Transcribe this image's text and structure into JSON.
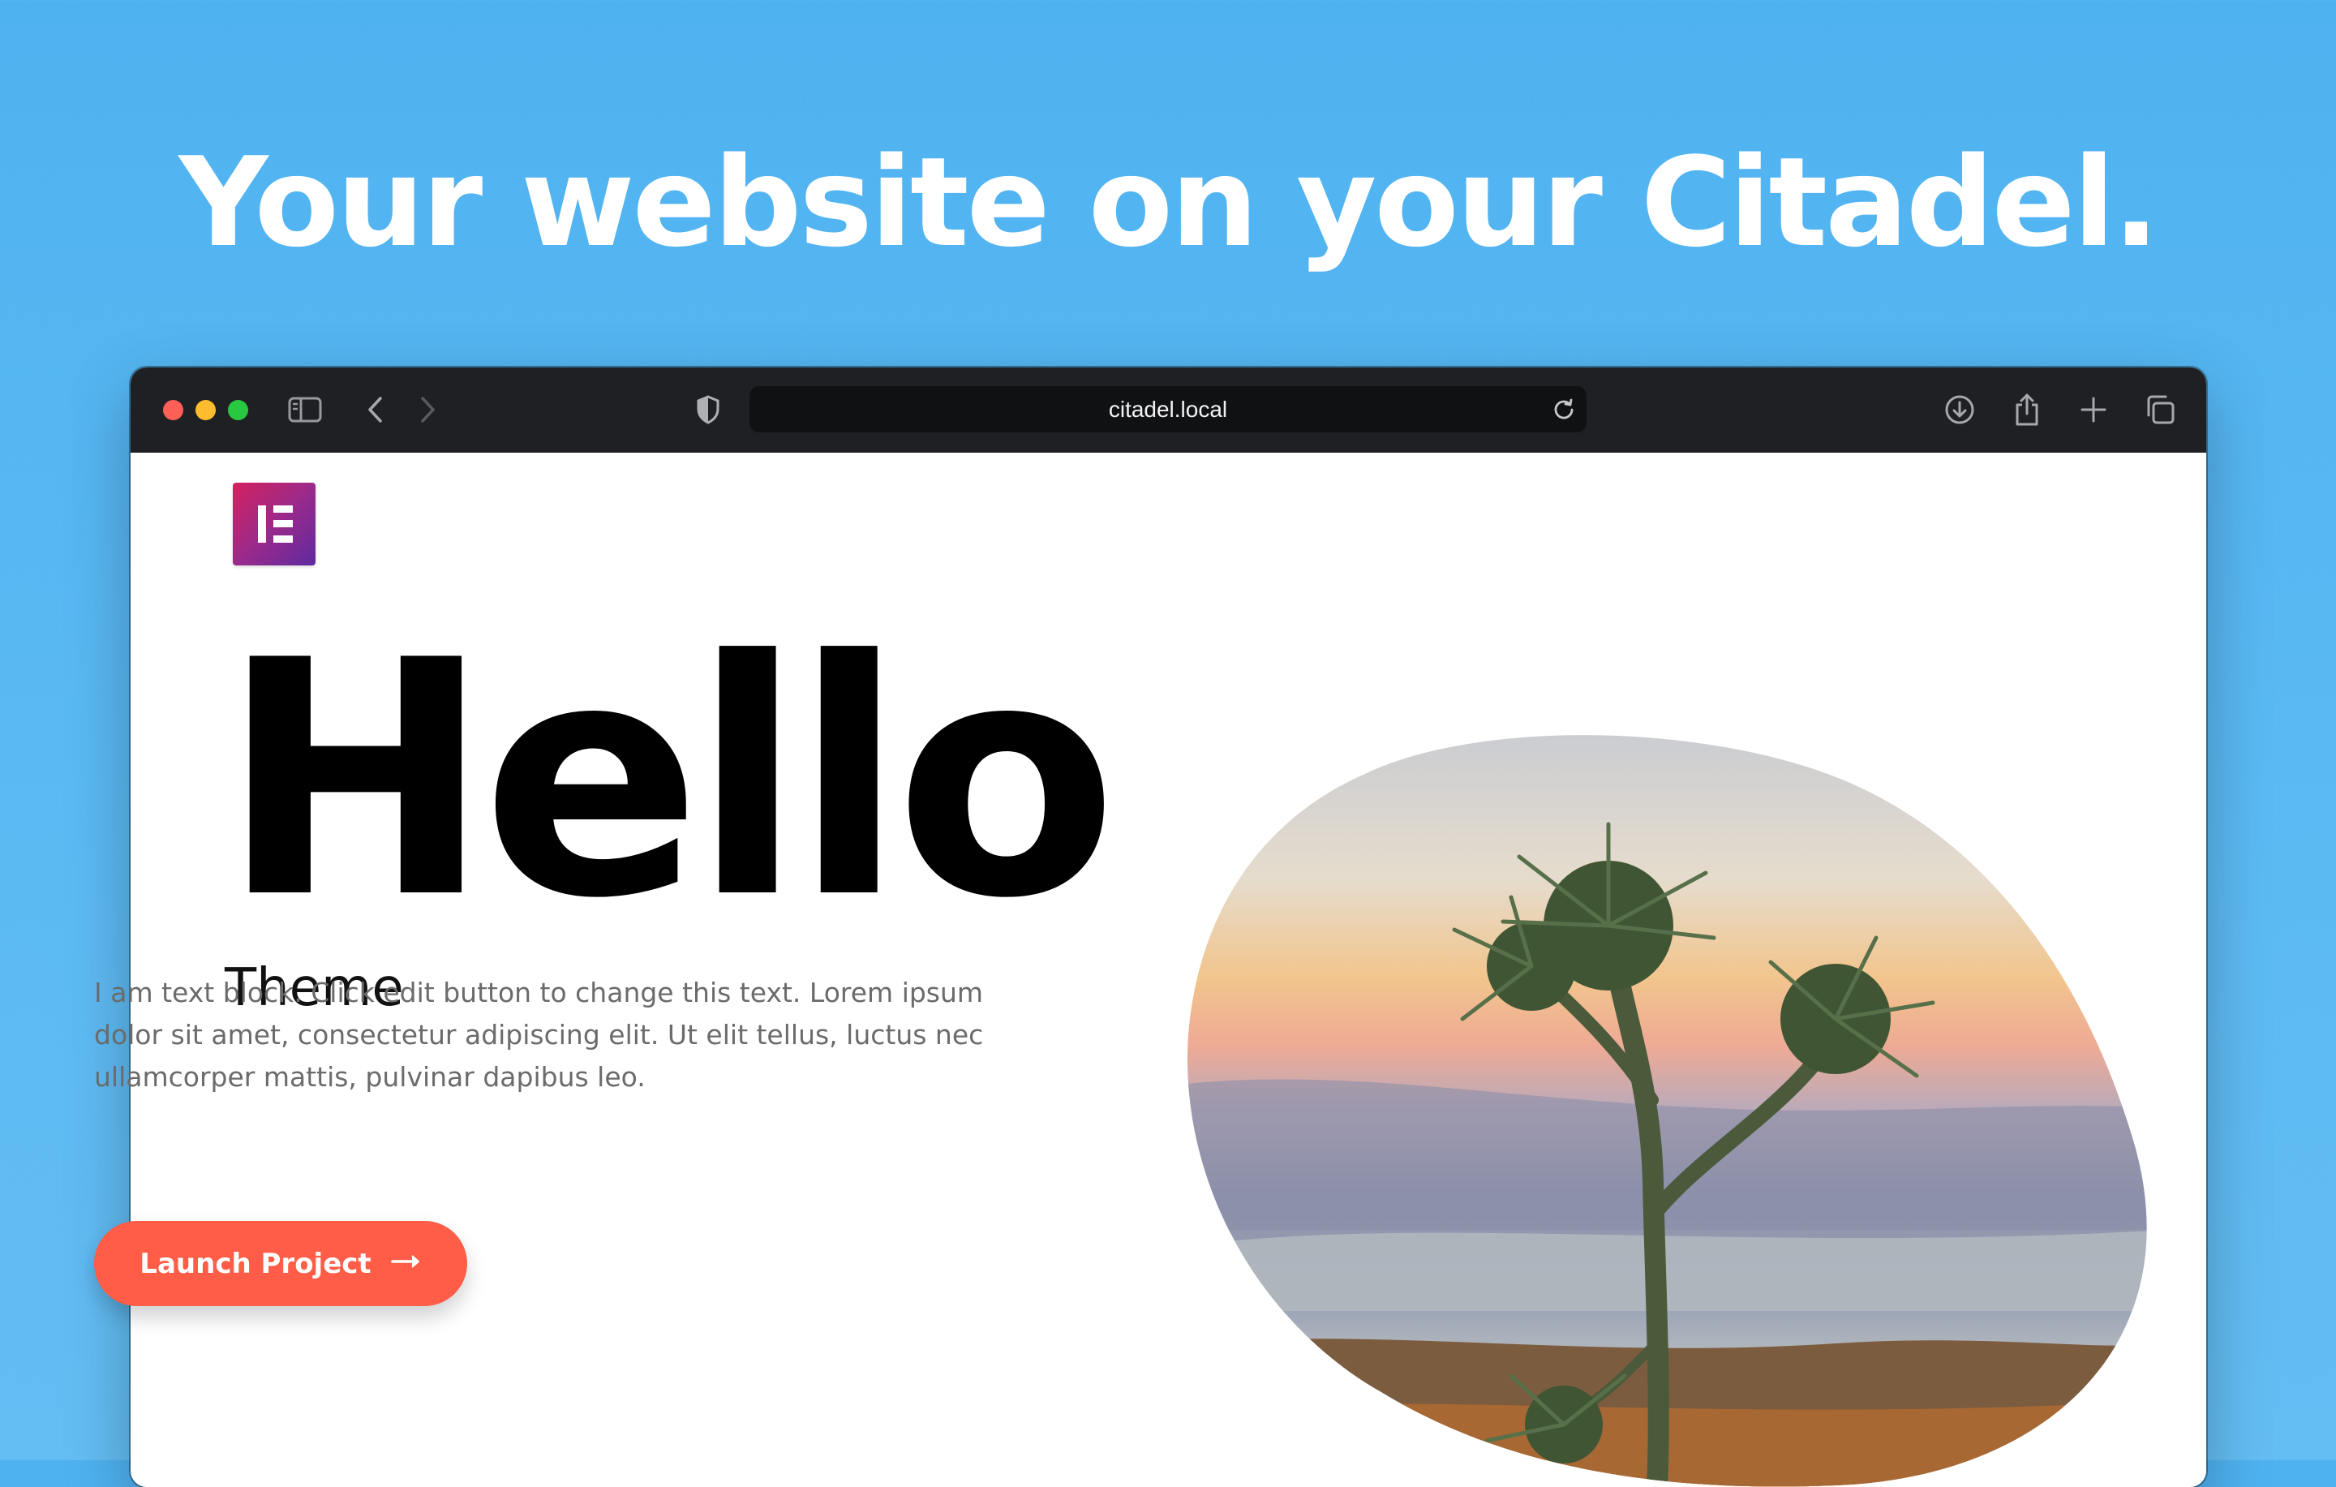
{
  "headline": "Your website on your Citadel.",
  "browser": {
    "url": "citadel.local",
    "icons": [
      "close-dot",
      "minimize-dot",
      "zoom-dot",
      "sidebar-icon",
      "back-icon",
      "forward-icon",
      "shield-icon",
      "reload-icon",
      "download-icon",
      "share-icon",
      "new-tab-icon",
      "tabs-overview-icon"
    ]
  },
  "page": {
    "logo_icon": "elementor-logo",
    "hero_title": "Hello",
    "subtitle": "Theme",
    "body": "I am text block. Click edit button to change this text. Lorem ipsum dolor sit amet, consectetur adipiscing elit. Ut elit tellus, luctus nec ullamcorper mattis, pulvinar dapibus leo.",
    "cta_label": "Launch Project",
    "cta_icon": "arrow-right-icon",
    "image_alt": "thistle plant at sunset"
  },
  "colors": {
    "background": "#55b6f2",
    "toolbar": "#1f2023",
    "accent_button": "#ff5d47",
    "logo_gradient": [
      "#d2215e",
      "#5e2aa0"
    ]
  }
}
